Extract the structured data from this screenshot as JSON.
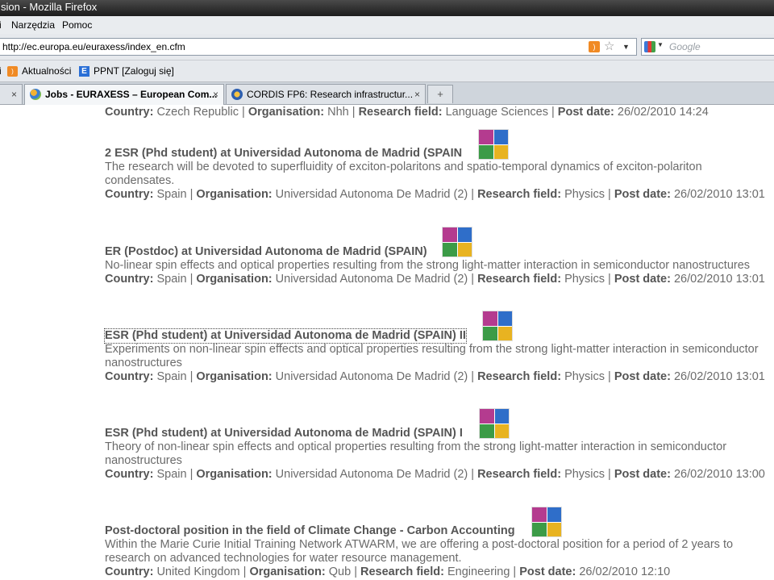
{
  "browser": {
    "title": "sion - Mozilla Firefox",
    "menu": [
      "i",
      "Narzędzia",
      "Pomoc"
    ],
    "url": "http://ec.europa.eu/euraxess/index_en.cfm",
    "search_placeholder": "Google",
    "bookmarks": [
      "i",
      "Aktualności",
      "PPNT [Zaloguj się]"
    ],
    "tabs": [
      {
        "label": "×",
        "active": false
      },
      {
        "label": "Jobs - EURAXESS – European Com...",
        "active": true
      },
      {
        "label": "CORDIS FP6: Research infrastructur...",
        "active": false
      }
    ],
    "new_tab": "+"
  },
  "labels": {
    "country": "Country:",
    "organisation": "Organisation:",
    "research_field": "Research field:",
    "post_date": "Post date:",
    "sep": " | "
  },
  "jobs": [
    {
      "title": "",
      "description": "",
      "country": "Czech Republic",
      "organisation": "Nhh",
      "field": "Language Sciences",
      "date": "26/02/2010 14:24"
    },
    {
      "title": "2 ESR (Phd student) at Universidad Autonoma de Madrid (SPAIN",
      "description": "The research will be devoted to superfluidity of exciton-polaritons and spatio-temporal dynamics of exciton-polariton condensates.",
      "country": "Spain",
      "organisation": "Universidad Autonoma De Madrid (2)",
      "field": "Physics",
      "date": "26/02/2010 13:01"
    },
    {
      "title": "ER (Postdoc) at Universidad Autonoma de Madrid (SPAIN)",
      "description": "No-linear spin effects and optical properties resulting from the strong light-matter interaction in semiconductor nanostructures",
      "country": "Spain",
      "organisation": "Universidad Autonoma De Madrid (2)",
      "field": "Physics",
      "date": "26/02/2010 13:01"
    },
    {
      "title": "ESR (Phd student) at Universidad Autonoma de Madrid (SPAIN) II",
      "description": "Experiments on non-linear spin effects and optical properties resulting from the strong light-matter interaction in semiconductor nanostructures",
      "country": "Spain",
      "organisation": "Universidad Autonoma De Madrid (2)",
      "field": "Physics",
      "date": "26/02/2010 13:01"
    },
    {
      "title": "ESR (Phd student) at Universidad Autonoma de Madrid (SPAIN) I",
      "description": "Theory of non-linear spin effects and optical properties resulting from the strong light-matter interaction in semiconductor nanostructures",
      "country": "Spain",
      "organisation": "Universidad Autonoma De Madrid (2)",
      "field": "Physics",
      "date": "26/02/2010 13:00"
    },
    {
      "title": "Post-doctoral position in the field of Climate Change - Carbon Accounting",
      "description": "Within the Marie Curie Initial Training Network ATWARM, we are offering a post-doctoral position for a period of 2 years to research on advanced technologies for water resource management.",
      "country": "United Kingdom",
      "organisation": "Qub",
      "field": "Engineering",
      "date": "26/02/2010 12:10"
    }
  ]
}
